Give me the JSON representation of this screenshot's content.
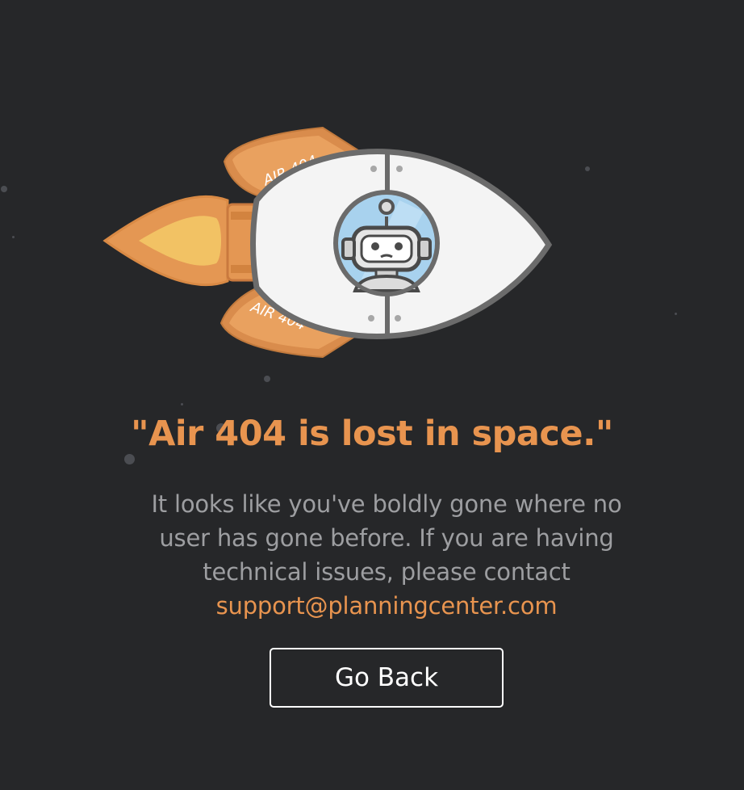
{
  "illustration": {
    "fin_label_top": "AIR 404",
    "fin_label_bottom": "AIR 404",
    "icon": "rocket-with-robot-icon"
  },
  "headline": "\"Air 404 is lost in space.\"",
  "message": {
    "text": "It looks like you've boldly gone where no user has gone before. If you are having technical issues, please contact",
    "email": "support@planningcenter.com"
  },
  "go_back": {
    "label": "Go Back"
  },
  "colors": {
    "background": "#262729",
    "accent": "#e8944f",
    "body_text": "#9d9ea1",
    "button_border": "#ffffff"
  }
}
